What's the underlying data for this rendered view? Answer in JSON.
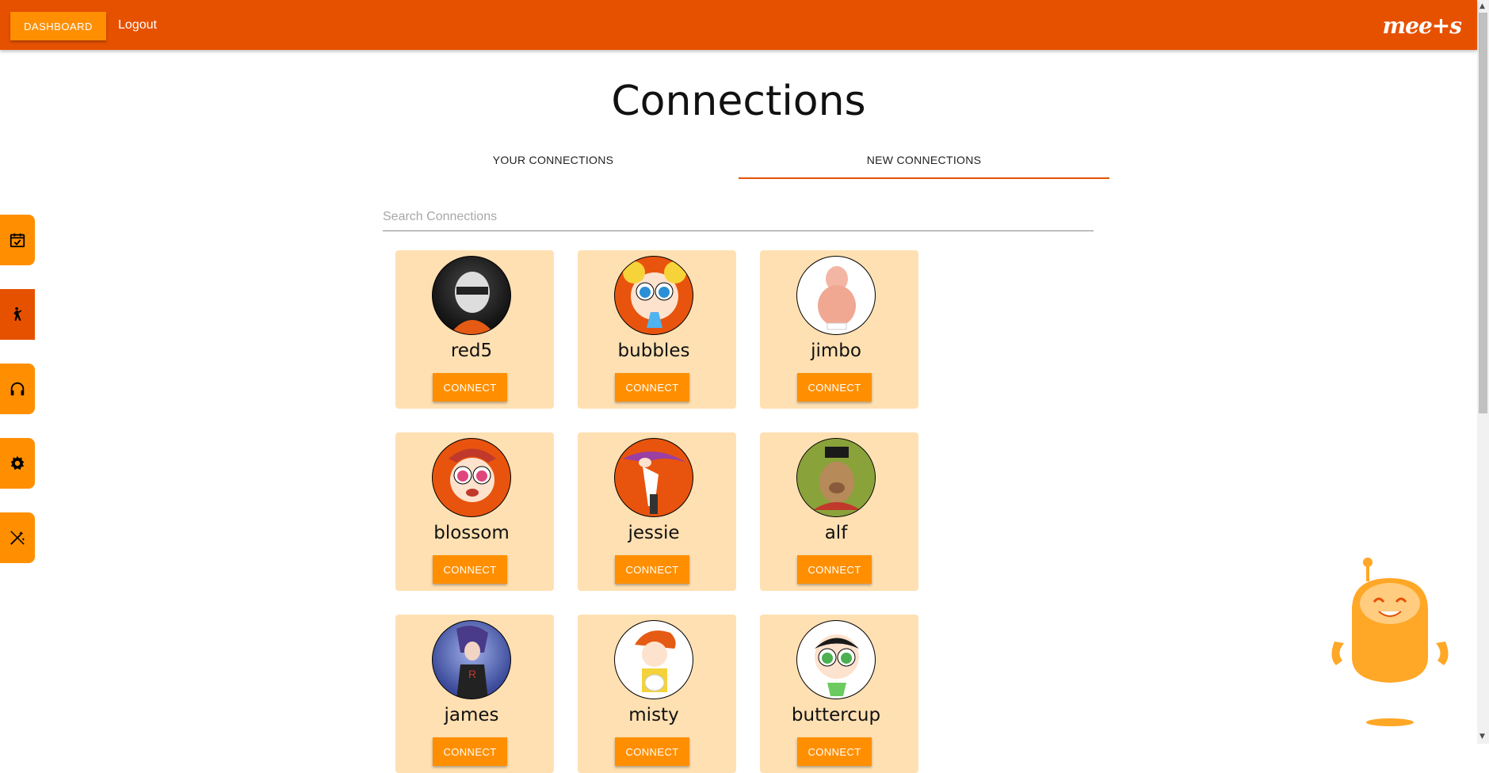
{
  "topbar": {
    "dashboard_label": "DASHBOARD",
    "logout_label": "Logout",
    "logo_text": "mee+s",
    "color": "#e65100"
  },
  "page": {
    "title": "Connections"
  },
  "tabs": [
    {
      "label": "YOUR CONNECTIONS",
      "active": false
    },
    {
      "label": "NEW CONNECTIONS",
      "active": true
    }
  ],
  "search": {
    "placeholder": "Search Connections",
    "value": ""
  },
  "cards": [
    {
      "username": "red5",
      "button": "CONNECT",
      "avatar_bg": "#2b2b2b"
    },
    {
      "username": "bubbles",
      "button": "CONNECT",
      "avatar_bg": "#e8540e"
    },
    {
      "username": "jimbo",
      "button": "CONNECT",
      "avatar_bg": "#ffffff"
    },
    {
      "username": "blossom",
      "button": "CONNECT",
      "avatar_bg": "#e8540e"
    },
    {
      "username": "jessie",
      "button": "CONNECT",
      "avatar_bg": "#e8540e"
    },
    {
      "username": "alf",
      "button": "CONNECT",
      "avatar_bg": "#6b7f2a"
    },
    {
      "username": "james",
      "button": "CONNECT",
      "avatar_bg": "#3b4a9a"
    },
    {
      "username": "misty",
      "button": "CONNECT",
      "avatar_bg": "#ffffff"
    },
    {
      "username": "buttercup",
      "button": "CONNECT",
      "avatar_bg": "#ffffff"
    }
  ],
  "sidebar": [
    {
      "icon": "calendar-check-icon",
      "active": false
    },
    {
      "icon": "person-walking-icon",
      "active": true
    },
    {
      "icon": "headphones-icon",
      "active": false
    },
    {
      "icon": "gear-icon",
      "active": false
    },
    {
      "icon": "magic-wand-icon",
      "active": false
    }
  ],
  "colors": {
    "accent": "#ff8f00",
    "card_bg": "#ffe0b2",
    "primary": "#e65100"
  }
}
